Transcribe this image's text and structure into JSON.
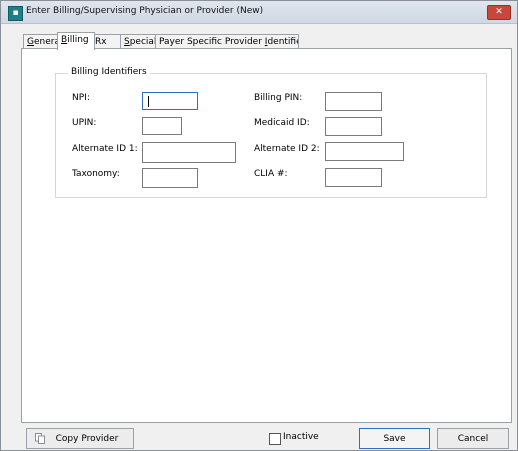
{
  "window": {
    "title": "Enter Billing/Supervising Physician or Provider  (New)",
    "app_icon": "square-app-icon",
    "close_glyph": "✕"
  },
  "tabs": [
    {
      "label_pre": "",
      "label_u": "G",
      "label_post": "eneral",
      "id": "general"
    },
    {
      "label_pre": "",
      "label_u": "B",
      "label_post": "illing",
      "id": "billing",
      "active": true
    },
    {
      "label_pre": "Rx",
      "label_u": "",
      "label_post": "",
      "id": "rx"
    },
    {
      "label_pre": "",
      "label_u": "S",
      "label_post": "pecial",
      "id": "special"
    },
    {
      "label_pre": "Payer Specific Provider ",
      "label_u": "I",
      "label_post": "dentifiers",
      "id": "payer"
    }
  ],
  "billing_identifiers": {
    "group_label": "Billing Identifiers",
    "npi": {
      "label": "NPI:",
      "value": ""
    },
    "billing_pin": {
      "label": "Billing PIN:",
      "value": ""
    },
    "upin": {
      "label": "UPIN:",
      "value": ""
    },
    "medicaid_id": {
      "label": "Medicaid ID:",
      "value": ""
    },
    "alternate_id_1": {
      "label": "Alternate ID 1:",
      "value": ""
    },
    "alternate_id_2": {
      "label": "Alternate ID 2:",
      "value": ""
    },
    "taxonomy": {
      "label": "Taxonomy:",
      "value": ""
    },
    "clia": {
      "label": "CLIA #:",
      "value": ""
    }
  },
  "footer": {
    "copy_provider": "Copy Provider",
    "inactive": "Inactive",
    "inactive_checked": false,
    "save": "Save",
    "cancel": "Cancel"
  },
  "colors": {
    "accent": "#2e6fbf",
    "close": "#c9473a",
    "app_icon": "#1f7f86"
  }
}
